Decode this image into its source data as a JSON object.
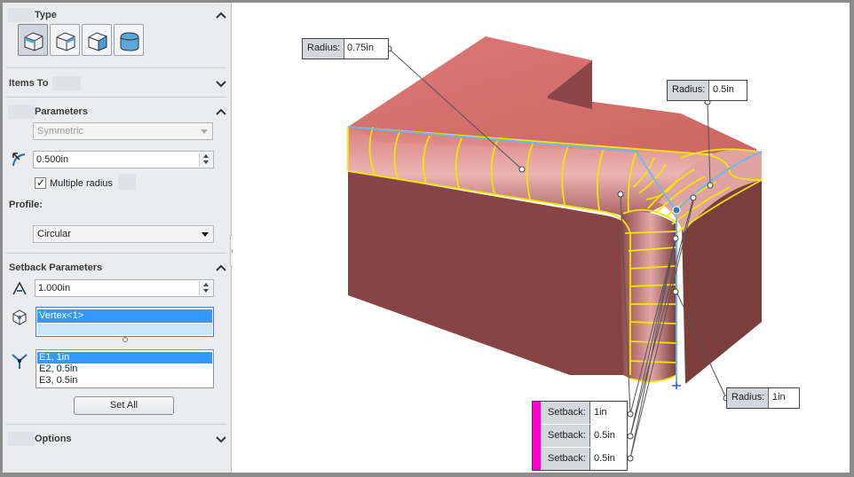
{
  "panel": {
    "type_section": {
      "title": "Type"
    },
    "type_buttons": [
      "constant-radius-fillet-icon",
      "variable-radius-fillet-icon",
      "face-fillet-icon",
      "full-round-fillet-icon"
    ],
    "items_section": {
      "title": "Items To"
    },
    "parameters_section": {
      "title": "Parameters",
      "method_value": "Symmetric",
      "radius_value": "0.500in",
      "multiple_radius_label": "Multiple radius",
      "multiple_radius_checked": true,
      "profile_label": "Profile:",
      "profile_value": "Circular"
    },
    "setback_section": {
      "title": "Setback Parameters",
      "distance_value": "1.000in",
      "vertex_items": [
        "Vertex<1>",
        ""
      ],
      "edge_items": [
        "E1, 1in",
        "E2, 0.5in",
        "E3, 0.5in"
      ],
      "set_all_label": "Set All"
    },
    "options_section": {
      "title": "Options"
    }
  },
  "graphics": {
    "callouts": {
      "radius_top_left": {
        "key": "Radius:",
        "value": "0.75in"
      },
      "radius_top_right": {
        "key": "Radius:",
        "value": "0.5in"
      },
      "radius_bottom": {
        "key": "Radius:",
        "value": "1in"
      }
    },
    "setbacks": [
      {
        "key": "Setback:",
        "value": "1in"
      },
      {
        "key": "Setback:",
        "value": "0.5in"
      },
      {
        "key": "Setback:",
        "value": "0.5in"
      }
    ],
    "colors": {
      "face_top": "#d6706d",
      "face_front": "#874444",
      "face_side": "#7a3c3c",
      "fillet_preview": "#f2e600",
      "selected_edge": "#69b8f0",
      "setback_marker": "#ff00cc"
    }
  }
}
